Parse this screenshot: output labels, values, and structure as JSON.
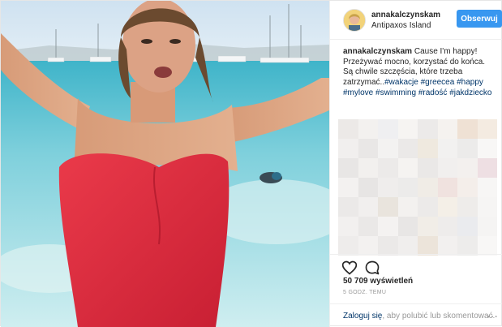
{
  "header": {
    "username": "annakalczynskam",
    "location": "Antipaxos Island",
    "follow_label": "Obserwuj"
  },
  "caption": {
    "username": "annakalczynskam",
    "text": "Cause I'm happy! Przeżywać mocno, korzystać do końca. Są chwile szczęścia, które trzeba zatrzymać..",
    "hashtags": [
      "#wakacje",
      "#greecea",
      "#happy",
      "#mylove",
      "#swimming",
      "#radość",
      "#jakdziecko"
    ]
  },
  "stats": {
    "views": "50 709 wyświetleń",
    "time": "5 GODZ. TEMU"
  },
  "footer": {
    "login_link": "Zaloguj się",
    "login_rest": ", aby polubić lub skomentować.",
    "more_label": "…"
  },
  "icons": {
    "like": "heart-icon",
    "comment": "comment-icon"
  },
  "colors": {
    "follow_bg": "#3897f0",
    "link": "#003569",
    "swimsuit": "#e0303f",
    "sea": "#6cc7d8"
  }
}
